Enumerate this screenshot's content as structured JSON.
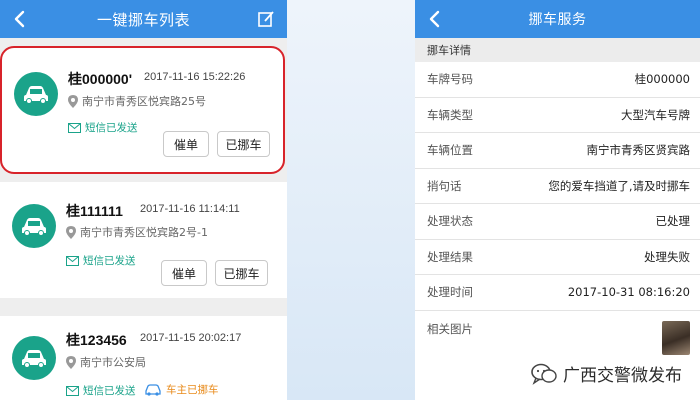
{
  "left": {
    "title": "一键挪车列表",
    "records": [
      {
        "plate": "桂000000'",
        "time": "2017-11-16 15:22:26",
        "address": "南宁市青秀区悦宾路25号",
        "sms": "短信已发送",
        "urge_label": "催单",
        "moved_label": "已挪车"
      },
      {
        "plate": "桂111111",
        "time": "2017-11-16 11:14:11",
        "address": "南宁市青秀区悦宾路2号-1",
        "sms": "短信已发送",
        "urge_label": "催单",
        "moved_label": "已挪车"
      },
      {
        "plate": "桂123456",
        "time": "2017-11-15 20:02:17",
        "address": "南宁市公安局",
        "sms": "短信已发送",
        "owner_moved": "车主已挪车"
      }
    ]
  },
  "right": {
    "title": "挪车服务",
    "section": "挪车详情",
    "rows": [
      {
        "label": "车牌号码",
        "value": "桂000000"
      },
      {
        "label": "车辆类型",
        "value": "大型汽车号牌"
      },
      {
        "label": "车辆位置",
        "value": "南宁市青秀区贤宾路"
      },
      {
        "label": "捎句话",
        "value": "您的爱车挡道了,请及时挪车"
      },
      {
        "label": "处理状态",
        "value": "已处理"
      },
      {
        "label": "处理结果",
        "value": "处理失败"
      },
      {
        "label": "处理时间",
        "value": "2017-10-31 08:16:20"
      }
    ],
    "photo_label": "相关图片"
  },
  "watermark": "广西交警微发布",
  "colors": {
    "header": "#3a8fe4",
    "accent_green": "#1aa38a",
    "highlight_red": "#d8232a",
    "owner_moved_orange": "#e88a1a"
  }
}
